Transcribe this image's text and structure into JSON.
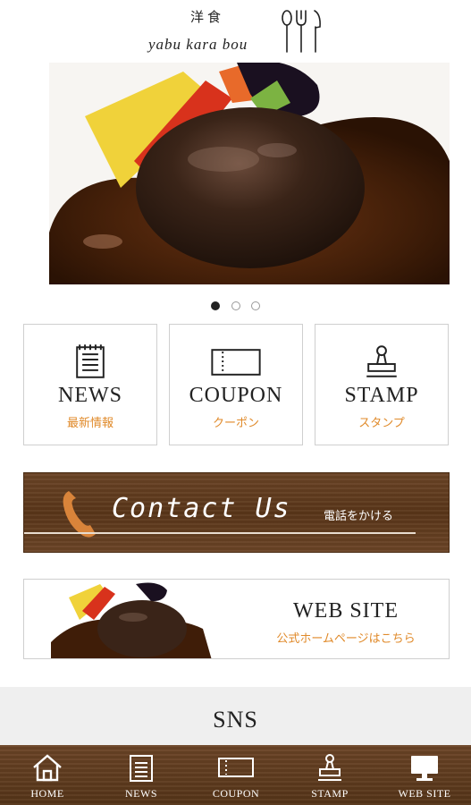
{
  "header": {
    "logo_jp": "洋食",
    "logo_en": "yabu kara bou"
  },
  "carousel": {
    "slide_count": 3,
    "active_index": 0
  },
  "menu_tiles": [
    {
      "label_en": "NEWS",
      "label_jp": "最新情報",
      "icon": "news-list-icon"
    },
    {
      "label_en": "COUPON",
      "label_jp": "クーポン",
      "icon": "coupon-ticket-icon"
    },
    {
      "label_en": "STAMP",
      "label_jp": "スタンプ",
      "icon": "stamp-icon"
    }
  ],
  "contact": {
    "title": "Contact Us",
    "sub": "電話をかける",
    "icon": "phone-icon"
  },
  "website": {
    "title": "WEB SITE",
    "sub": "公式ホームページはこちら"
  },
  "sns": {
    "title": "SNS"
  },
  "bottom_nav": [
    {
      "label": "HOME",
      "icon": "home-icon"
    },
    {
      "label": "NEWS",
      "icon": "news-list-icon"
    },
    {
      "label": "COUPON",
      "icon": "coupon-ticket-icon"
    },
    {
      "label": "STAMP",
      "icon": "stamp-icon"
    },
    {
      "label": "WEB SITE",
      "icon": "monitor-icon"
    }
  ],
  "colors": {
    "accent_orange": "#e08a2a",
    "wood_brown": "#5a3619",
    "tile_border": "#cfcfcf"
  }
}
